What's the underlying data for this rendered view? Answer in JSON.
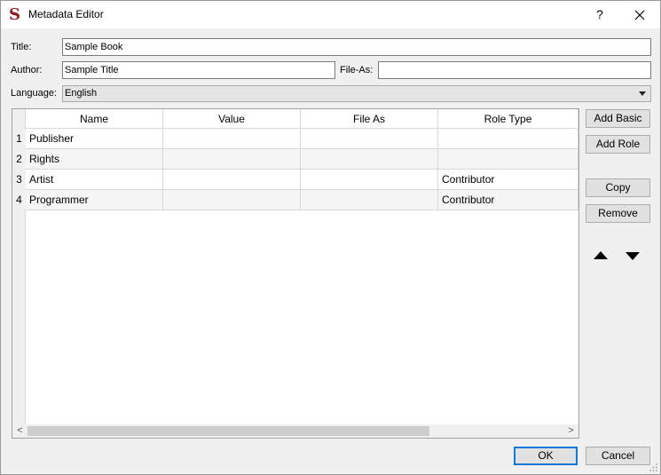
{
  "window": {
    "title": "Metadata Editor",
    "help_label": "?",
    "app_icon": "S"
  },
  "form": {
    "title_label": "Title:",
    "title_value": "Sample Book",
    "author_label": "Author:",
    "author_value": "Sample Title",
    "file_as_label": "File-As:",
    "file_as_value": "",
    "language_label": "Language:",
    "language_value": "English"
  },
  "table": {
    "columns": [
      "Name",
      "Value",
      "File As",
      "Role Type"
    ],
    "rows": [
      {
        "num": "1",
        "name": "Publisher",
        "value": "",
        "file_as": "",
        "role_type": ""
      },
      {
        "num": "2",
        "name": "Rights",
        "value": "",
        "file_as": "",
        "role_type": ""
      },
      {
        "num": "3",
        "name": "Artist",
        "value": "",
        "file_as": "",
        "role_type": "Contributor"
      },
      {
        "num": "4",
        "name": "Programmer",
        "value": "",
        "file_as": "",
        "role_type": "Contributor"
      }
    ],
    "scroll_left": "<",
    "scroll_right": ">"
  },
  "side_buttons": {
    "add_basic": "Add Basic",
    "add_role": "Add Role",
    "copy": "Copy",
    "remove": "Remove"
  },
  "footer": {
    "ok": "OK",
    "cancel": "Cancel"
  },
  "colors": {
    "app_icon": "#8b1e24",
    "default_button_border": "#0078d7"
  }
}
